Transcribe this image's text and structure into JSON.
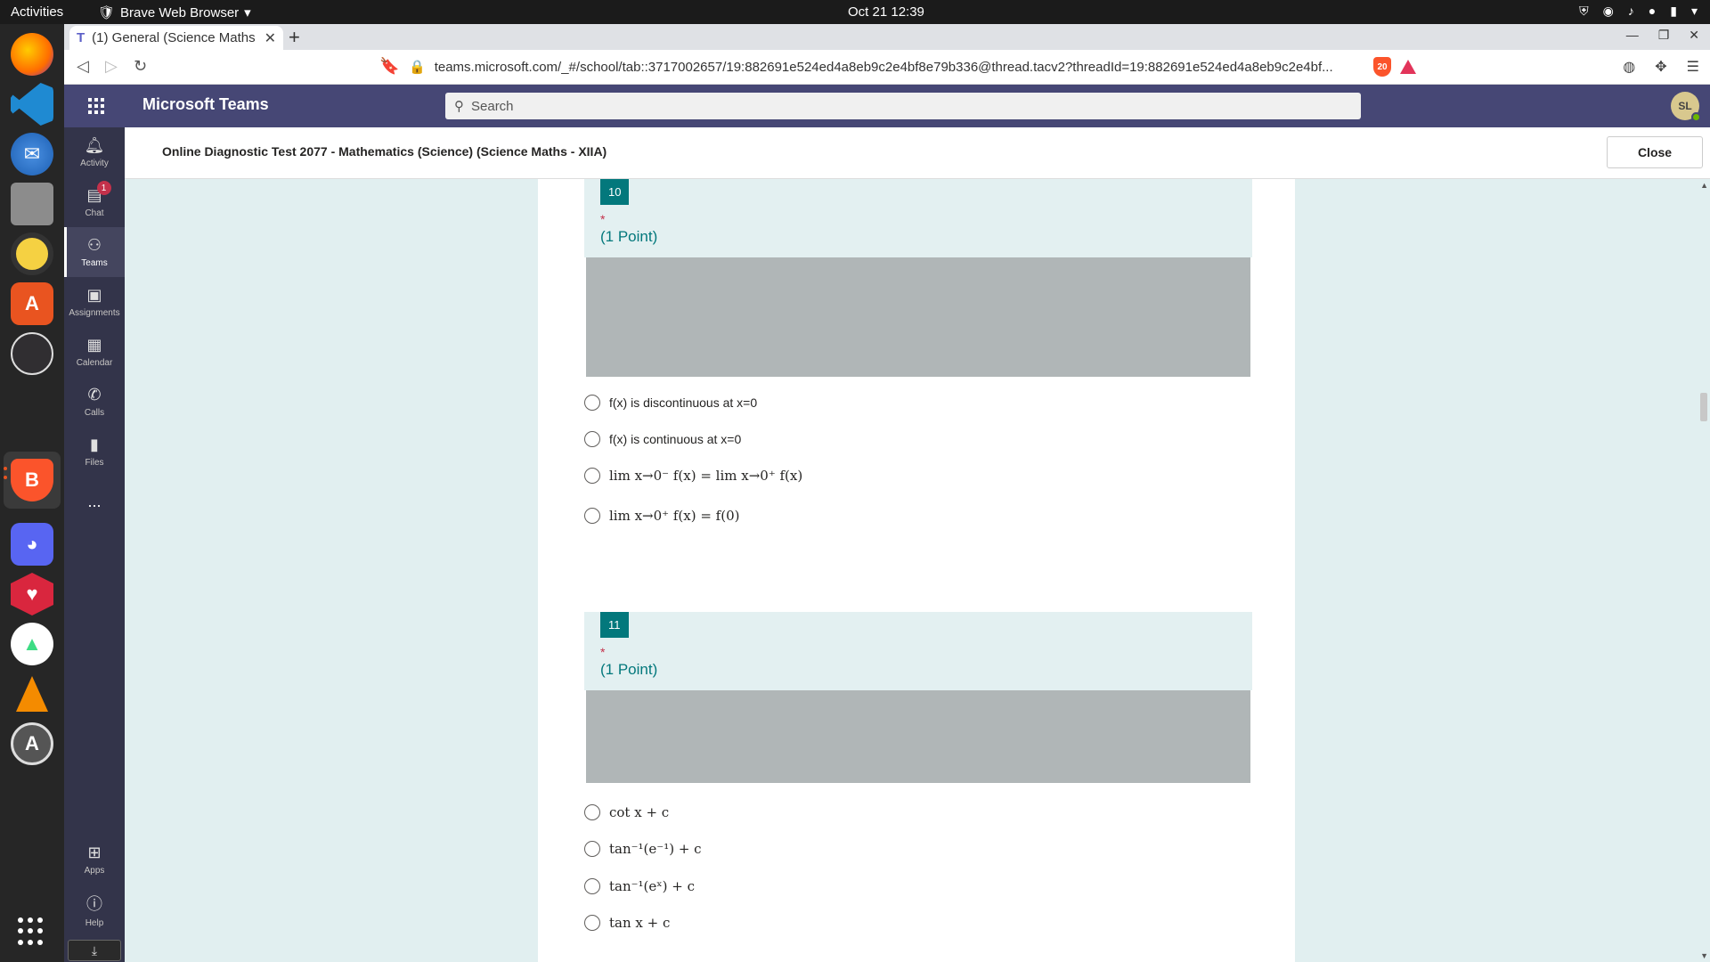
{
  "system_bar": {
    "activities": "Activities",
    "app_name": "Brave Web Browser",
    "clock": "Oct 21  12:39"
  },
  "dock": {
    "items": [
      "firefox-icon",
      "vscode-icon",
      "thunderbird-icon",
      "files-icon",
      "rhythmbox-icon",
      "software-center-icon",
      "obs-icon",
      "brave-icon",
      "discord-icon",
      "heart-app-icon",
      "android-studio-icon",
      "vlc-icon",
      "software-updater-icon"
    ]
  },
  "browser": {
    "tab_title": "(1) General (Science Maths",
    "url": "teams.microsoft.com/_#/school/tab::3717002657/19:882691e524ed4a8eb9c2e4bf8e79b336@thread.tacv2?threadId=19:882691e524ed4a8eb9c2e4bf...",
    "shield_count": "20"
  },
  "teams": {
    "title": "Microsoft Teams",
    "search_placeholder": "Search",
    "avatar_initials": "SL",
    "rail": [
      {
        "label": "Activity",
        "icon": "bell-icon"
      },
      {
        "label": "Chat",
        "icon": "chat-icon",
        "badge": "1"
      },
      {
        "label": "Teams",
        "icon": "teams-icon"
      },
      {
        "label": "Assignments",
        "icon": "assignments-icon"
      },
      {
        "label": "Calendar",
        "icon": "calendar-icon"
      },
      {
        "label": "Calls",
        "icon": "phone-icon"
      },
      {
        "label": "Files",
        "icon": "file-icon"
      }
    ],
    "rail_more": "...",
    "rail_bottom": [
      {
        "label": "Apps",
        "icon": "apps-icon"
      },
      {
        "label": "Help",
        "icon": "help-icon"
      }
    ]
  },
  "form": {
    "title": "Online Diagnostic Test 2077 - Mathematics (Science) (Science Maths - XIIA)",
    "close_label": "Close",
    "questions": [
      {
        "number": "10",
        "required": "*",
        "points": "(1 Point)",
        "options": [
          "f(x) is discontinuous at x=0",
          "f(x) is continuous at x=0",
          "lim x→0⁻ f(x) = lim x→0⁺ f(x)",
          "lim x→0⁺ f(x) = f(0)"
        ]
      },
      {
        "number": "11",
        "required": "*",
        "points": "(1 Point)",
        "options": [
          "cot x + c",
          "tan⁻¹(e⁻¹) + c",
          "tan⁻¹(eˣ) + c",
          "tan  x + c"
        ]
      }
    ]
  }
}
